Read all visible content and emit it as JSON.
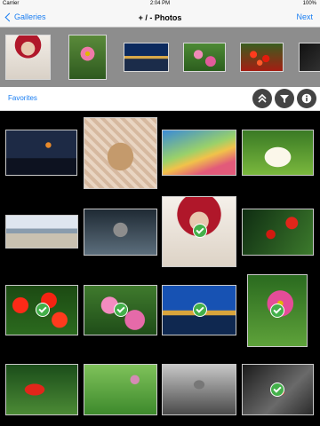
{
  "status_bar": {
    "carrier": "Carrier",
    "time": "2:04 PM",
    "battery": "100%"
  },
  "nav": {
    "back_label": "Galleries",
    "title": "+ / - Photos",
    "next_label": "Next"
  },
  "toolbar": {
    "label": "Favorites",
    "icons": [
      "double-chevron-up-icon",
      "filter-icon",
      "info-icon"
    ]
  },
  "colors": {
    "accent": "#1a7ef2",
    "check": "#43b04a",
    "strip_bg": "#8d8d8d"
  },
  "strip_thumbs": [
    "portrait",
    "pink flower",
    "city night",
    "pink flowers",
    "red berries",
    "dark"
  ],
  "grid_photos": [
    {
      "image": "moon",
      "selected": false
    },
    {
      "image": "goat",
      "selected": false
    },
    {
      "image": "rainbow",
      "selected": false
    },
    {
      "image": "lotus",
      "selected": false
    },
    {
      "image": "beach",
      "selected": false
    },
    {
      "image": "motorbike",
      "selected": false
    },
    {
      "image": "portrait",
      "selected": true
    },
    {
      "image": "red berries",
      "selected": false
    },
    {
      "image": "red flowers",
      "selected": true
    },
    {
      "image": "cosmos",
      "selected": true
    },
    {
      "image": "city night",
      "selected": true
    },
    {
      "image": "pink flower",
      "selected": true
    },
    {
      "image": "red flower",
      "selected": false
    },
    {
      "image": "green blur",
      "selected": false
    },
    {
      "image": "bird",
      "selected": false
    },
    {
      "image": "black and white",
      "selected": true
    }
  ]
}
